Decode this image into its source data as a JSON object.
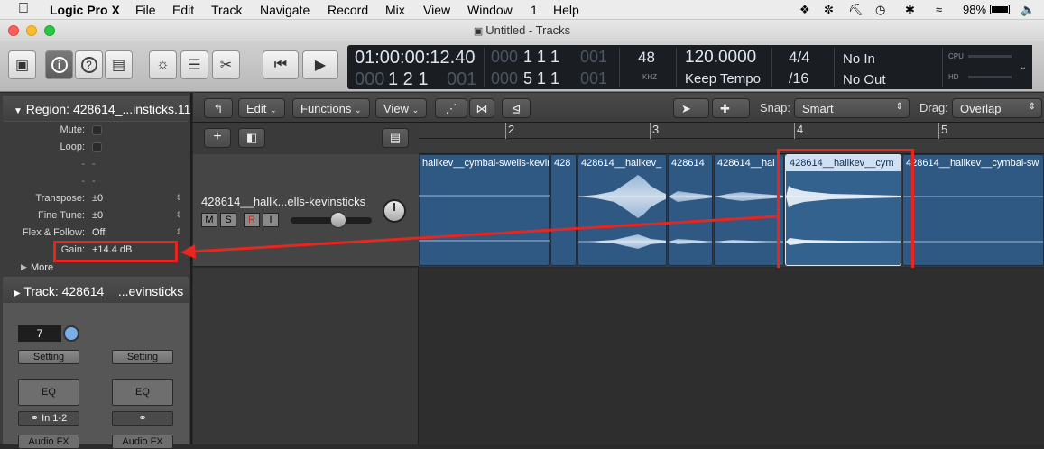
{
  "menubar": {
    "app": "Logic Pro X",
    "items": [
      "File",
      "Edit",
      "Track",
      "Navigate",
      "Record",
      "Mix",
      "View",
      "Window",
      "1",
      "Help"
    ],
    "battery": "98%"
  },
  "window": {
    "title": "Untitled - Tracks"
  },
  "lcd": {
    "time": "01:00:00:12.40",
    "time_dim": "000",
    "bars": "1  2  1",
    "bars_dim": "001",
    "sub1_dim": "000",
    "sub1": "1  1  1",
    "sub1_tail": "001",
    "sub2_dim": "000",
    "sub2": "5  1  1",
    "sub2_tail": "001",
    "khz_val": "48",
    "khz_label": "KHZ",
    "tempo": "120.0000",
    "tempo_mode": "Keep Tempo",
    "sig": "4/4",
    "div": "/16",
    "in": "No In",
    "out": "No Out",
    "cpu": "CPU",
    "hd": "HD"
  },
  "inspector": {
    "region_header": "Region: 428614_...insticks.11",
    "rows": [
      {
        "label": "Mute:",
        "value": ""
      },
      {
        "label": "Loop:",
        "value": ""
      },
      {
        "label": "-",
        "value": "-"
      },
      {
        "label": "-",
        "value": "-"
      },
      {
        "label": "Transpose:",
        "value": "±0"
      },
      {
        "label": "Fine Tune:",
        "value": "±0"
      },
      {
        "label": "Flex & Follow:",
        "value": "Off"
      },
      {
        "label": "Gain:",
        "value": "+14.4 dB"
      }
    ],
    "more": "More",
    "track_header": "Track:  428614__...evinsticks",
    "fader_value": "7",
    "setting": "Setting",
    "eq": "EQ",
    "input": "In 1-2",
    "audio_fx": "Audio FX"
  },
  "arrange": {
    "edit": "Edit",
    "functions": "Functions",
    "view": "View",
    "snap_label": "Snap:",
    "snap_value": "Smart",
    "drag_label": "Drag:",
    "drag_value": "Overlap",
    "ruler": [
      "2",
      "3",
      "4",
      "5"
    ],
    "track_name": "428614__hallk...ells-kevinsticks",
    "m": "M",
    "s": "S",
    "r": "R",
    "i": "I"
  },
  "regions": [
    "hallkev__cymbal-swells-kevin",
    "428",
    "428614__hallkev_",
    "428614",
    "428614__hal",
    "428614__hallkev__cym",
    "428614__hallkev__cymbal-sw"
  ],
  "colors": {
    "highlight": "#e8251e",
    "region": "#2f5983",
    "region_selected_label": "#cfe0f2"
  }
}
